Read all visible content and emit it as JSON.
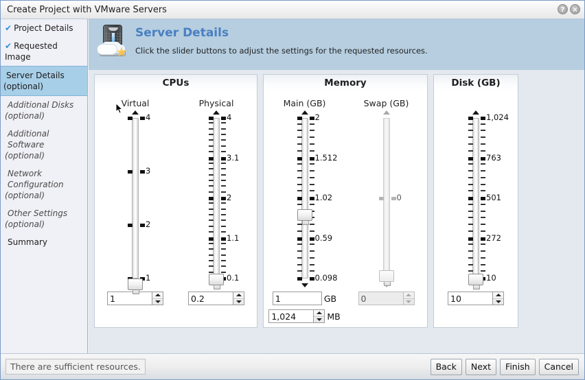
{
  "window": {
    "title": "Create Project with VMware Servers",
    "help_button": "?",
    "close_button": "×"
  },
  "sidebar": {
    "items": [
      {
        "label": "Project Details",
        "state": "done",
        "check": "✔"
      },
      {
        "label": "Requested Image",
        "state": "done",
        "check": "✔"
      },
      {
        "label": "Server Details",
        "sub": "(optional)",
        "state": "selected"
      },
      {
        "label": "Additional Disks",
        "sub": "(optional)",
        "state": "optional"
      },
      {
        "label": "Additional Software",
        "sub": "(optional)",
        "state": "optional"
      },
      {
        "label": "Network Configuration",
        "sub": "(optional)",
        "state": "optional"
      },
      {
        "label": "Other Settings",
        "sub": "(optional)",
        "state": "optional"
      },
      {
        "label": "Summary",
        "state": "plain"
      }
    ]
  },
  "header": {
    "icon": "server-cloud-icon",
    "title": "Server Details",
    "subtitle": "Click the slider buttons to adjust the settings for the requested resources."
  },
  "panels": [
    {
      "title": "CPUs",
      "columns": [
        {
          "label": "Virtual",
          "slider": {
            "enabled": true,
            "value": 1,
            "thumb_position_pct": 100,
            "major_ticks": [
              "4",
              "3",
              "2",
              "1"
            ],
            "minor_per_gap": 0
          },
          "field": {
            "value": "1",
            "spinner": true,
            "unit": ""
          }
        },
        {
          "label": "Physical",
          "slider": {
            "enabled": true,
            "value": 0.2,
            "thumb_position_pct": 97,
            "major_ticks": [
              "4",
              "3.1",
              "2",
              "1.1",
              "0.1"
            ],
            "minor_per_gap": 6
          },
          "field": {
            "value": "0.2",
            "spinner": true,
            "unit": ""
          }
        }
      ]
    },
    {
      "title": "Memory",
      "columns": [
        {
          "label": "Main (GB)",
          "slider": {
            "enabled": true,
            "value": 1.02,
            "thumb_position_pct": 57,
            "major_ticks": [
              "2",
              "1.512",
              "1.02",
              "0.59",
              "0.098"
            ],
            "minor_per_gap": 5
          },
          "field": {
            "value": "1",
            "spinner": false,
            "unit": "GB"
          },
          "field2": {
            "value": "1,024",
            "spinner": true,
            "unit": "MB"
          }
        },
        {
          "label": "Swap (GB)",
          "slider": {
            "enabled": false,
            "value": 0,
            "thumb_position_pct": 95,
            "major_ticks": [
              "0"
            ],
            "minor_per_gap": 0
          },
          "field": {
            "value": "0",
            "spinner": true,
            "unit": ""
          }
        }
      ]
    },
    {
      "title": "Disk (GB)",
      "columns": [
        {
          "label": "",
          "slider": {
            "enabled": true,
            "value": 10,
            "thumb_position_pct": 97,
            "major_ticks": [
              "1,024",
              "763",
              "501",
              "272",
              "10"
            ],
            "minor_per_gap": 5
          },
          "field": {
            "value": "10",
            "spinner": true,
            "unit": ""
          }
        }
      ]
    }
  ],
  "statusbar": {
    "message": "There are sufficient resources.",
    "buttons": [
      "Back",
      "Next",
      "Finish",
      "Cancel"
    ]
  },
  "colors": {
    "accent": "#4a7fc1",
    "header_band": "#b6cee0",
    "selected_sidebar": "#a8cfe8",
    "content_bg": "#e3e9ef"
  }
}
